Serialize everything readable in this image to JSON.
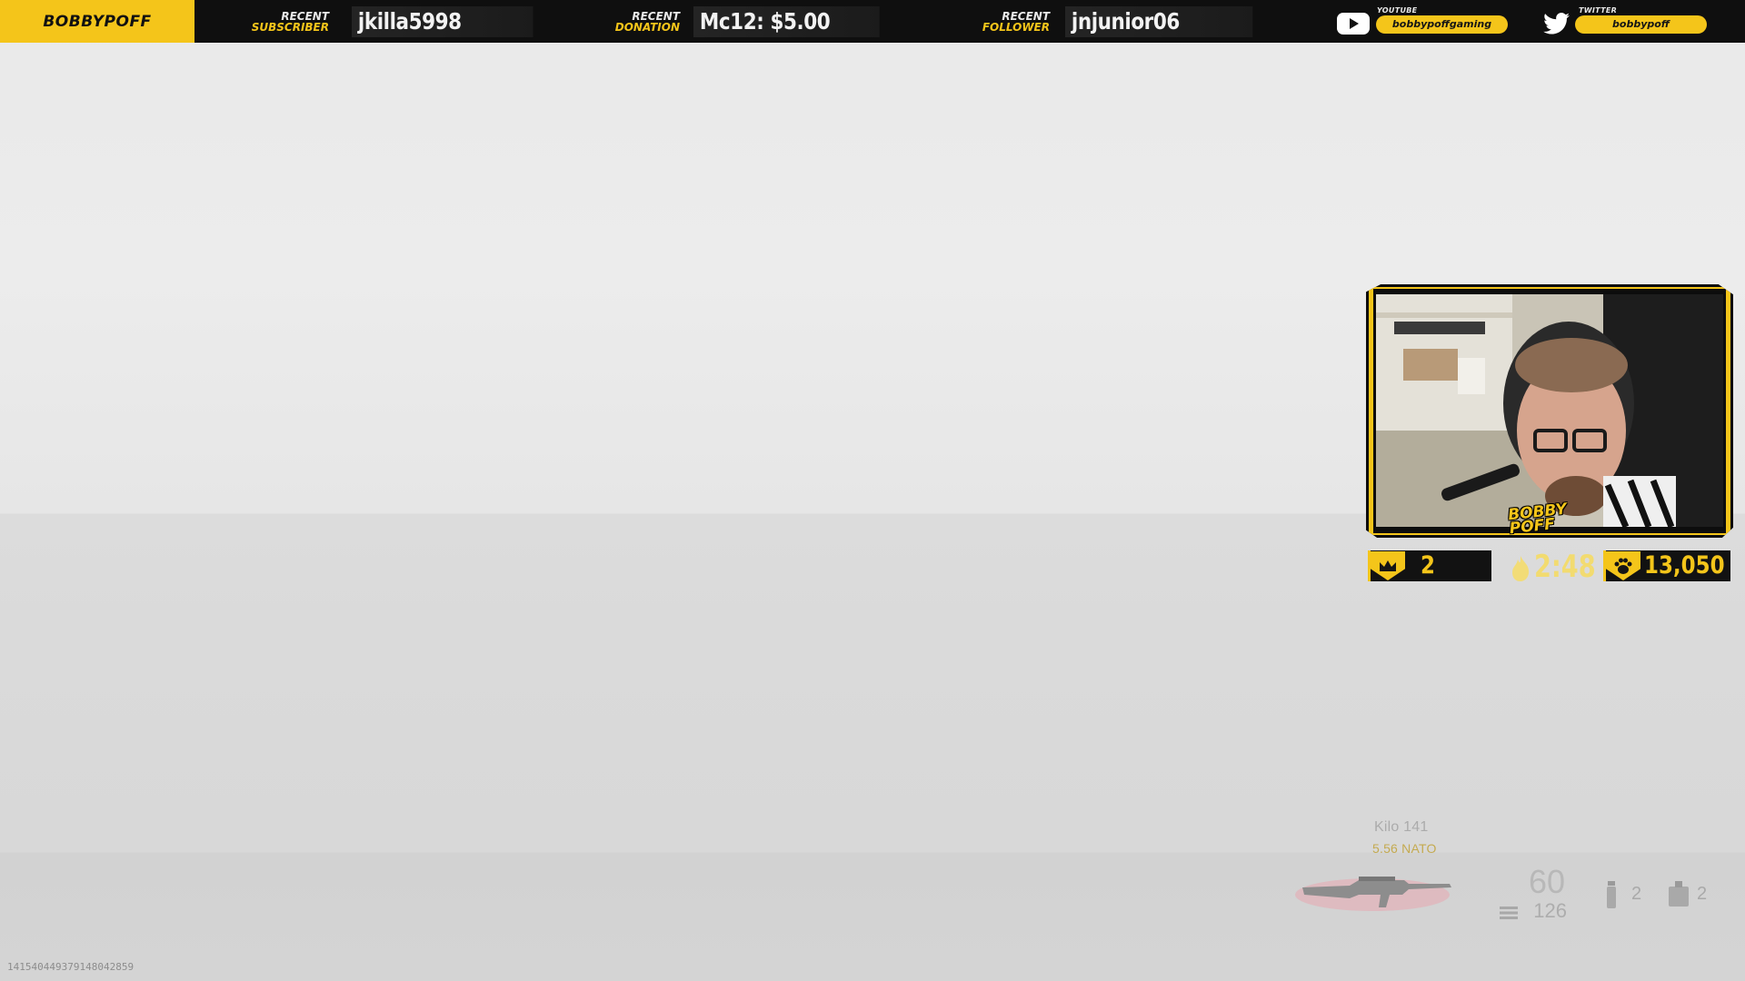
{
  "topbar": {
    "brand": "BOBBYPOFF",
    "subscriber": {
      "label_line1": "RECENT",
      "label_line2": "SUBSCRIBER",
      "value": "jkilla5998"
    },
    "donation": {
      "label_line1": "RECENT",
      "label_line2": "DONATION",
      "value": "Mc12: $5.00"
    },
    "follower": {
      "label_line1": "RECENT",
      "label_line2": "FOLLOWER",
      "value": "jnjunior06"
    },
    "youtube": {
      "caption": "YOUTUBE",
      "handle": "bobbypoffgaming",
      "icon": "youtube-icon"
    },
    "twitter": {
      "caption": "TWITTER",
      "handle": "bobbypoff",
      "icon": "twitter-icon"
    },
    "accent_color": "#f4c51a"
  },
  "webcam": {
    "logo_line1": "BOBBY",
    "logo_line2": "POFF",
    "stats": {
      "kills": "2",
      "timer": "2:48",
      "followers": "13,050",
      "kills_icon": "crown-skull-icon",
      "timer_icon": "flame-icon",
      "followers_icon": "paw-icon"
    }
  },
  "hud": {
    "weapon_name": "Kilo 141",
    "ammo_type": "5.56 NATO",
    "magazine": "60",
    "reserve": "126",
    "lethal_count": "2",
    "tactical_count": "2"
  },
  "debug_id": "14154044937914804285​9"
}
